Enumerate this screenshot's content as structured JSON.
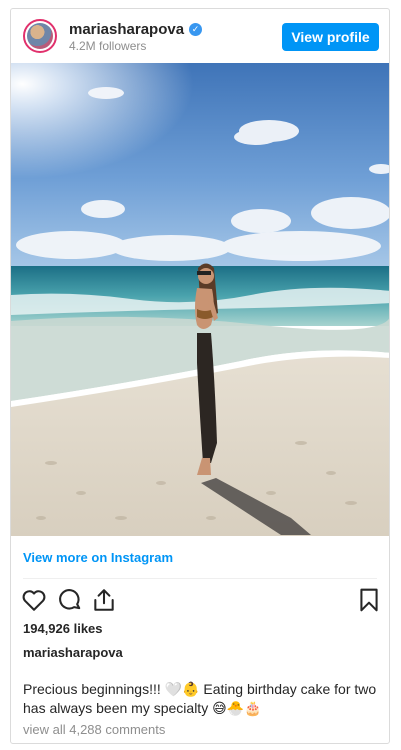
{
  "header": {
    "username": "mariasharapova",
    "followers": "4.2M followers",
    "view_profile_label": "View profile"
  },
  "post": {
    "image_icon": "beach-photo",
    "view_more_label": "View more on Instagram",
    "likes": "194,926 likes",
    "caption_username": "mariasharapova",
    "caption": "Precious beginnings!!! 🤍👶 Eating birthday cake for two has always been my specialty 😅🐣🎂",
    "comments_label": "view all 4,288 comments"
  },
  "colors": {
    "accent": "#0095f6",
    "verified": "#3897f0",
    "text": "#262626",
    "muted": "#8e8e8e"
  },
  "icons": [
    "heart-icon",
    "comment-icon",
    "share-icon",
    "bookmark-icon",
    "verified-badge-icon"
  ]
}
